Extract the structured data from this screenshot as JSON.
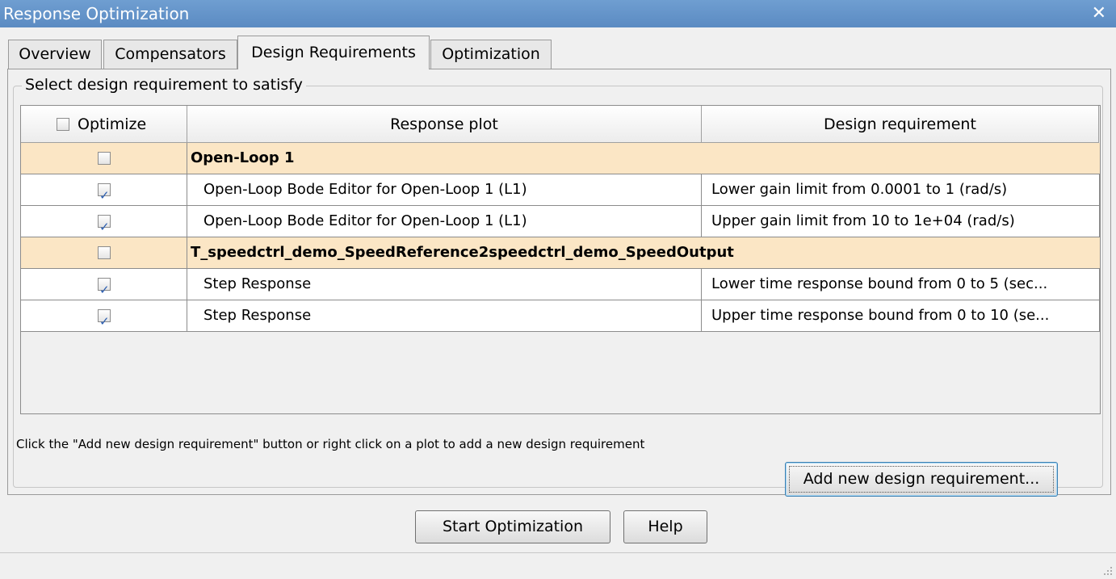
{
  "window": {
    "title": "Response Optimization",
    "close_glyph": "✕"
  },
  "tabs": [
    {
      "label": "Overview",
      "active": false
    },
    {
      "label": "Compensators",
      "active": false
    },
    {
      "label": "Design Requirements",
      "active": true
    },
    {
      "label": "Optimization",
      "active": false
    }
  ],
  "panel": {
    "group_title": "Select design requirement to satisfy",
    "table": {
      "headers": {
        "optimize": "Optimize",
        "response_plot": "Response plot",
        "design_requirement": "Design requirement"
      },
      "header_checkbox_checked": false,
      "rows": [
        {
          "type": "group",
          "checked": false,
          "response_plot": "Open-Loop 1",
          "design_requirement": ""
        },
        {
          "type": "item",
          "checked": true,
          "response_plot": "Open-Loop Bode Editor for Open-Loop 1 (L1)",
          "design_requirement": "Lower gain limit from 0.0001 to 1 (rad/s)"
        },
        {
          "type": "item",
          "checked": true,
          "response_plot": "Open-Loop Bode Editor for Open-Loop 1 (L1)",
          "design_requirement": "Upper gain limit from 10 to 1e+04 (rad/s)"
        },
        {
          "type": "group",
          "checked": false,
          "response_plot": "T_speedctrl_demo_SpeedReference2speedctrl_demo_SpeedOutput",
          "design_requirement": ""
        },
        {
          "type": "item",
          "checked": true,
          "response_plot": "Step Response",
          "design_requirement": "Lower time response bound from 0 to 5 (sec..."
        },
        {
          "type": "item",
          "checked": true,
          "response_plot": "Step Response",
          "design_requirement": "Upper time response bound from 0 to 10 (se..."
        }
      ]
    },
    "hint": "Click the \"Add new design requirement\" button or right click on a plot to add a new design requirement",
    "add_button": "Add new design requirement..."
  },
  "footer": {
    "start_button": "Start Optimization",
    "help_button": "Help"
  },
  "icons": {
    "resize_grip": "resize-grip-icon"
  },
  "colors": {
    "titlebar": "#5b8bc2",
    "group_row": "#fbe6c5",
    "checkbox_check": "#2a5db0"
  }
}
